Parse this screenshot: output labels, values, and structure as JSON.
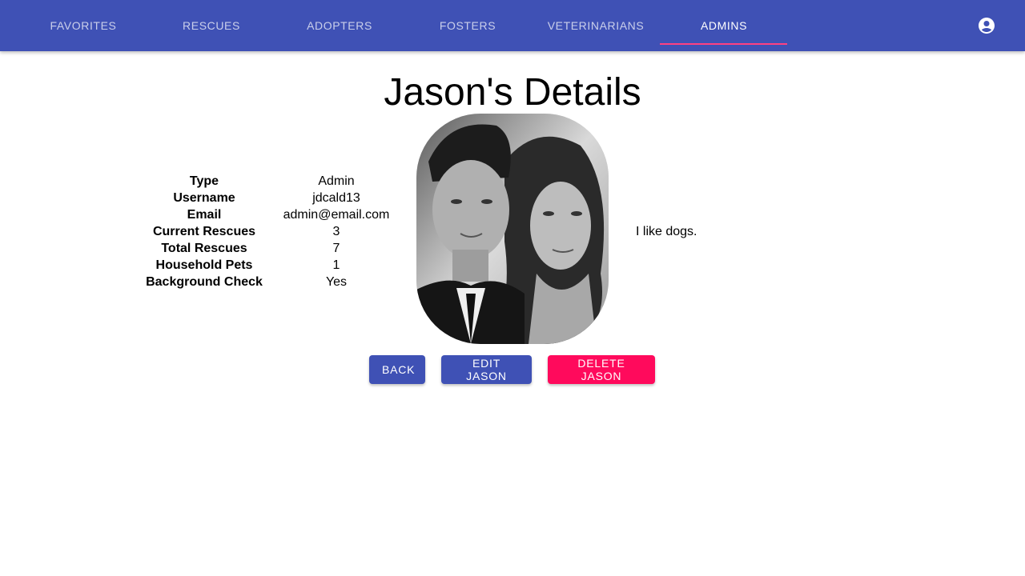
{
  "nav": {
    "tabs": [
      {
        "label": "FAVORITES"
      },
      {
        "label": "RESCUES"
      },
      {
        "label": "ADOPTERS"
      },
      {
        "label": "FOSTERS"
      },
      {
        "label": "VETERINARIANS"
      },
      {
        "label": "ADMINS"
      }
    ],
    "active_tab": "ADMINS",
    "account_icon": "account-circle-icon"
  },
  "page": {
    "title": "Jason's Details"
  },
  "details": [
    {
      "label": "Type",
      "value": "Admin"
    },
    {
      "label": "Username",
      "value": "jdcald13"
    },
    {
      "label": "Email",
      "value": "admin@email.com"
    },
    {
      "label": "Current Rescues",
      "value": "3"
    },
    {
      "label": "Total Rescues",
      "value": "7"
    },
    {
      "label": "Household Pets",
      "value": "1"
    },
    {
      "label": "Background Check",
      "value": "Yes"
    }
  ],
  "bio": "I like dogs.",
  "actions": {
    "back": "BACK",
    "edit": "EDIT JASON",
    "delete": "DELETE JASON"
  },
  "colors": {
    "primary": "#3f51b5",
    "accent": "#ff4081",
    "warn": "#ff0a5c"
  }
}
